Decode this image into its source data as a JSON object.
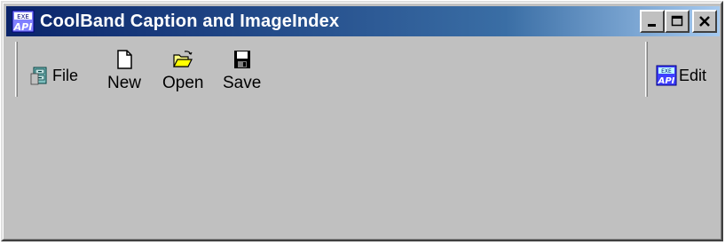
{
  "window": {
    "title": "CoolBand Caption and ImageIndex",
    "app_icon": "api-app-icon",
    "caption_buttons": {
      "minimize_icon": "minimize-icon",
      "maximize_icon": "maximize-icon",
      "close_icon": "close-icon"
    }
  },
  "rebar": {
    "bands": [
      {
        "caption": "File",
        "icon": "file-cabinet-icon",
        "buttons": [
          {
            "label": "New",
            "icon": "new-document-icon"
          },
          {
            "label": "Open",
            "icon": "open-folder-icon"
          },
          {
            "label": "Save",
            "icon": "save-disk-icon"
          }
        ]
      },
      {
        "caption": "Edit",
        "icon": "api-edit-icon",
        "buttons": []
      }
    ]
  },
  "colors": {
    "title_start": "#0a246a",
    "title_end": "#a6caf0",
    "face": "#c0c0c0"
  }
}
